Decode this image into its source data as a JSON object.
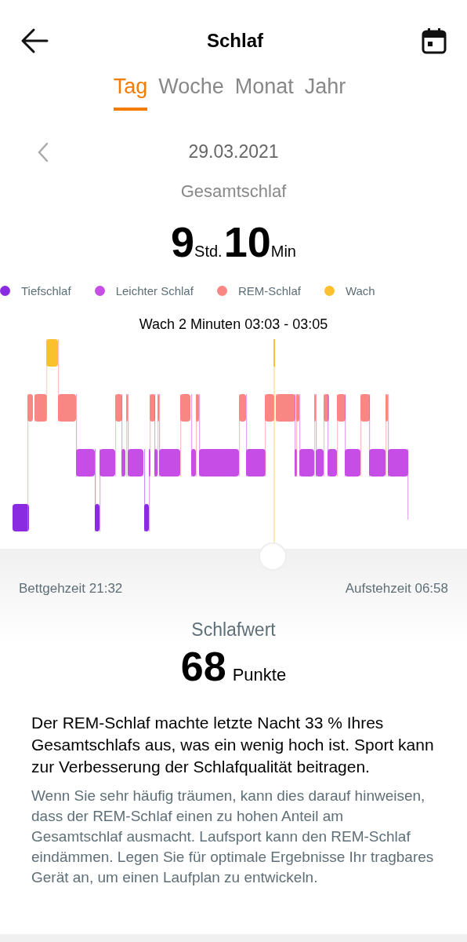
{
  "header": {
    "title": "Schlaf"
  },
  "tabs": [
    {
      "label": "Tag",
      "selected": true
    },
    {
      "label": "Woche",
      "selected": false
    },
    {
      "label": "Monat",
      "selected": false
    },
    {
      "label": "Jahr",
      "selected": false
    }
  ],
  "date": "29.03.2021",
  "total": {
    "label": "Gesamtschlaf",
    "hours": "9",
    "hours_unit": "Std.",
    "minutes": "10",
    "minutes_unit": "Min"
  },
  "legend": [
    {
      "label": "Tiefschlaf",
      "color": "#8a2be2"
    },
    {
      "label": "Leichter Schlaf",
      "color": "#c64ee6"
    },
    {
      "label": "REM-Schlaf",
      "color": "#f88683"
    },
    {
      "label": "Wach",
      "color": "#fbc02d"
    }
  ],
  "tooltip": "Wach 2 Minuten 03:03 - 03:05",
  "bedtime": "Bettgehzeit 21:32",
  "wakeup": "Aufstehzeit 06:58",
  "score": {
    "label": "Schlafwert",
    "value": "68",
    "unit": "Punkte"
  },
  "summary": "Der REM-Schlaf machte letzte Nacht 33 % Ihres Gesamtschlafs aus, was ein wenig hoch ist. Sport kann zur Verbesserung der Schlafqualität beitragen.",
  "advice": "Wenn Sie sehr häufig träumen, kann dies darauf hinweisen, dass der REM-Schlaf einen zu hohen Anteil am Gesamtschlaf ausmacht. Laufsport kann den REM-Schlaf eindämmen. Legen Sie für optimale Ergebnisse Ihr tragbares Gerät an, um einen Laufplan zu entwickeln."
}
